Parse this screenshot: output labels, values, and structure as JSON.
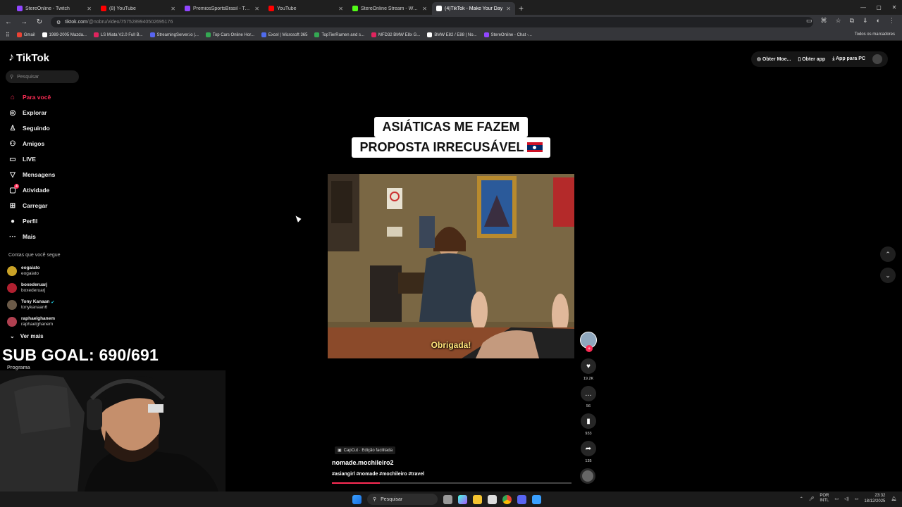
{
  "browser": {
    "tabs": [
      {
        "title": "StereOnline - Twitch",
        "color": "#9146ff",
        "active": false
      },
      {
        "title": "(8) YouTube",
        "color": "#ff0000",
        "active": false
      },
      {
        "title": "PremiosSportsBrasil - Twitch",
        "color": "#9146ff",
        "active": false
      },
      {
        "title": "YouTube",
        "color": "#ff0000",
        "active": false
      },
      {
        "title": "StereOnline Stream - Watch Liv",
        "color": "#53fc18",
        "active": false
      },
      {
        "title": "(4)TikTok - Make Your Day",
        "color": "#ffffff",
        "active": true
      }
    ],
    "new_tab": "+",
    "url_domain": "tiktok.com",
    "url_path": "/@nobru/video/7575289940502695176",
    "bookmarks": [
      {
        "label": "Gmail",
        "color": "#ea4335"
      },
      {
        "label": "1989-2005 Mazda...",
        "color": "#ffffff"
      },
      {
        "label": "LS Miata V2.0 Full B...",
        "color": "#e0245e"
      },
      {
        "label": "StreamingServer.io |...",
        "color": "#5865f2"
      },
      {
        "label": "Top Cars Online Hor...",
        "color": "#34a853"
      },
      {
        "label": "Excel | Microsoft 365",
        "color": "#4f6bed"
      },
      {
        "label": "TopTierRamen and s...",
        "color": "#34a853"
      },
      {
        "label": "MFD32 BMW E8x G...",
        "color": "#e0245e"
      },
      {
        "label": "BMW E82 / E88 | No...",
        "color": "#ffffff"
      },
      {
        "label": "StereOnline - Chat -...",
        "color": "#9146ff"
      }
    ],
    "bookmarks_all": "Todos os marcadores"
  },
  "tiktok": {
    "logo": "TikTok",
    "search_placeholder": "Pesquisar",
    "nav": [
      {
        "label": "Para você",
        "icon": "⌂",
        "active": true,
        "name": "home-icon"
      },
      {
        "label": "Explorar",
        "icon": "◎",
        "active": false,
        "name": "compass-icon"
      },
      {
        "label": "Seguindo",
        "icon": "♙",
        "active": false,
        "name": "following-icon"
      },
      {
        "label": "Amigos",
        "icon": "⚇",
        "active": false,
        "name": "friends-icon"
      },
      {
        "label": "LIVE",
        "icon": "▭",
        "active": false,
        "name": "live-icon"
      },
      {
        "label": "Mensagens",
        "icon": "▽",
        "active": false,
        "name": "messages-icon"
      },
      {
        "label": "Atividade",
        "icon": "▢",
        "active": false,
        "name": "activity-icon",
        "badge": "4"
      },
      {
        "label": "Carregar",
        "icon": "⊞",
        "active": false,
        "name": "upload-icon"
      },
      {
        "label": "Perfil",
        "icon": "●",
        "active": false,
        "name": "profile-icon"
      },
      {
        "label": "Mais",
        "icon": "···",
        "active": false,
        "name": "more-icon"
      }
    ],
    "following_heading": "Contas que você segue",
    "following": [
      {
        "name": "eogaiato",
        "handle": "eogaiato",
        "color": "#c9a227"
      },
      {
        "name": "boxederuarj",
        "handle": "boxederuarj",
        "color": "#b02030"
      },
      {
        "name": "Tony Kanaan",
        "handle": "tonykanaan6",
        "color": "#6b5a48",
        "verified": true
      },
      {
        "name": "raphaelghanem",
        "handle": "raphaelghanem",
        "color": "#b04050"
      }
    ],
    "see_more": "Ver mais",
    "top_actions": [
      "Obter Moe...",
      "Obter app",
      "App para PC"
    ],
    "video": {
      "caption_line1": "ASIÁTICAS ME FAZEM",
      "caption_line2": "PROPOSTA IRRECUSÁVEL",
      "subtitle": "Obrigada!",
      "effect_label": "CapCut · Edição facilitada",
      "username": "nomade.mochileiro2",
      "hashtags": "#asiangirl #nomade #mochileiro #travel",
      "progress": 0.2
    },
    "actions": {
      "likes": "19.2K",
      "comments": "56",
      "saves": "933",
      "shares": "135"
    }
  },
  "overlay": {
    "sub_goal": "SUB GOAL: 690/691",
    "programa": "Programa"
  },
  "taskbar": {
    "search": "Pesquisar",
    "lang_1": "POR",
    "lang_2": "INTL",
    "time": "23:32",
    "date": "18/12/2025"
  }
}
